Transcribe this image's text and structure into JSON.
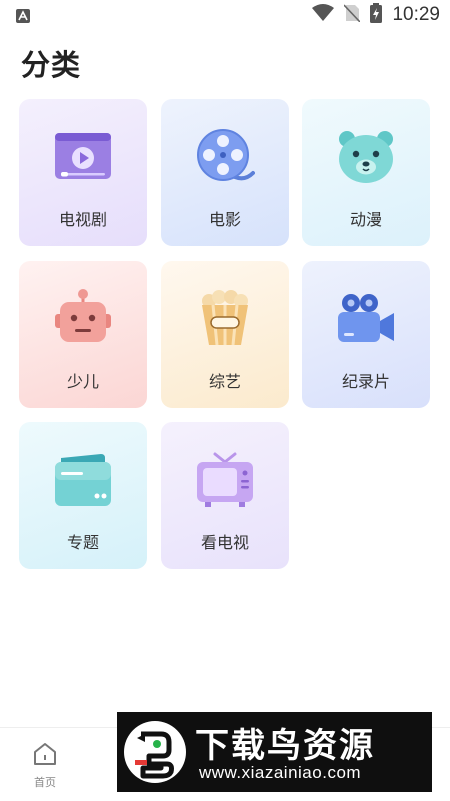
{
  "status_bar": {
    "time": "10:29"
  },
  "page_title": "分类",
  "categories": [
    {
      "label": "电视剧",
      "icon": "tv-series-icon"
    },
    {
      "label": "电影",
      "icon": "film-reel-icon"
    },
    {
      "label": "动漫",
      "icon": "anime-bear-icon"
    },
    {
      "label": "少儿",
      "icon": "robot-icon"
    },
    {
      "label": "综艺",
      "icon": "popcorn-icon"
    },
    {
      "label": "纪录片",
      "icon": "video-camera-icon"
    },
    {
      "label": "专题",
      "icon": "folder-card-icon"
    },
    {
      "label": "看电视",
      "icon": "retro-tv-icon"
    }
  ],
  "bottom_nav": {
    "home_label": "首页"
  },
  "watermark": {
    "title": "下载鸟资源",
    "url": "www.xiazainiao.com"
  }
}
